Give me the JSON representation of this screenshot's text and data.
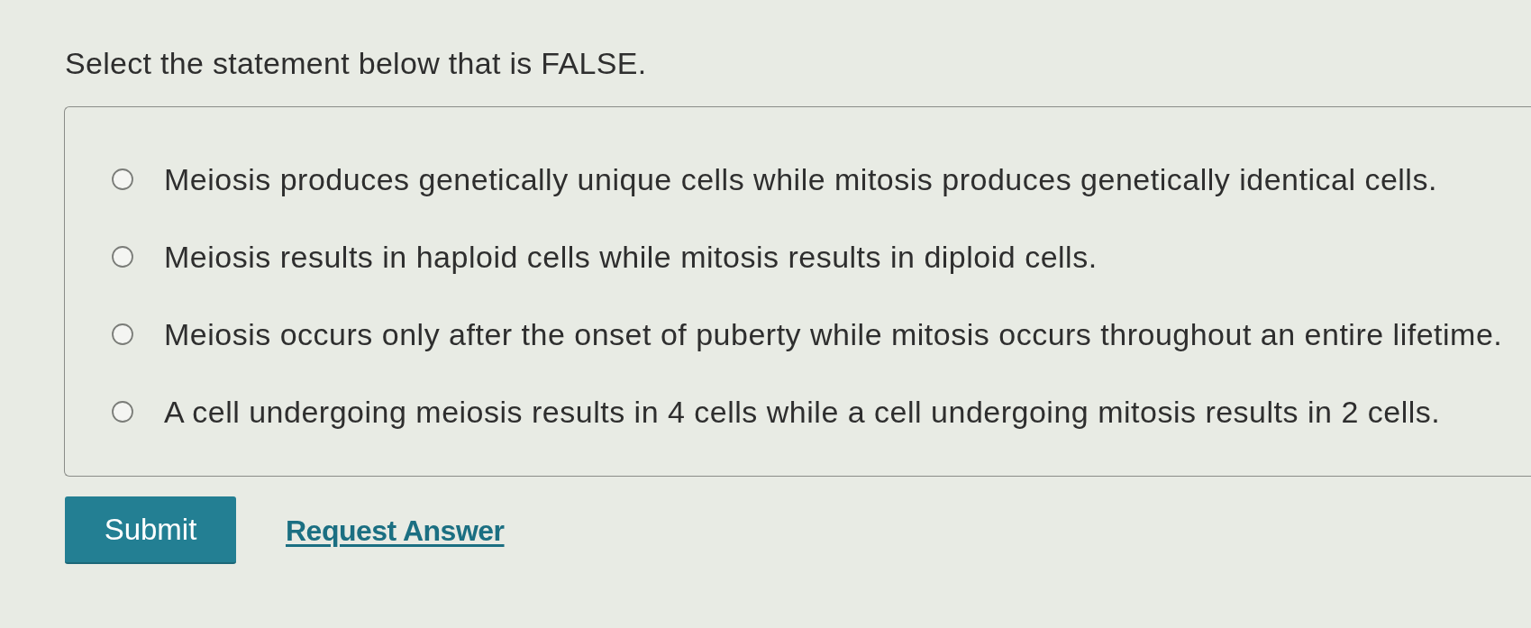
{
  "question": "Select the statement below that is FALSE.",
  "options": [
    {
      "label": "Meiosis produces genetically unique cells while mitosis produces genetically identical cells.",
      "selected": false
    },
    {
      "label": "Meiosis results in haploid cells while mitosis results in diploid cells.",
      "selected": false
    },
    {
      "label": "Meiosis occurs only after the onset of puberty while mitosis occurs throughout an entire lifetime.",
      "selected": false
    },
    {
      "label": "A cell undergoing meiosis results in 4 cells while a cell undergoing mitosis results in 2 cells.",
      "selected": false
    }
  ],
  "actions": {
    "submit": "Submit",
    "request_answer": "Request Answer"
  }
}
